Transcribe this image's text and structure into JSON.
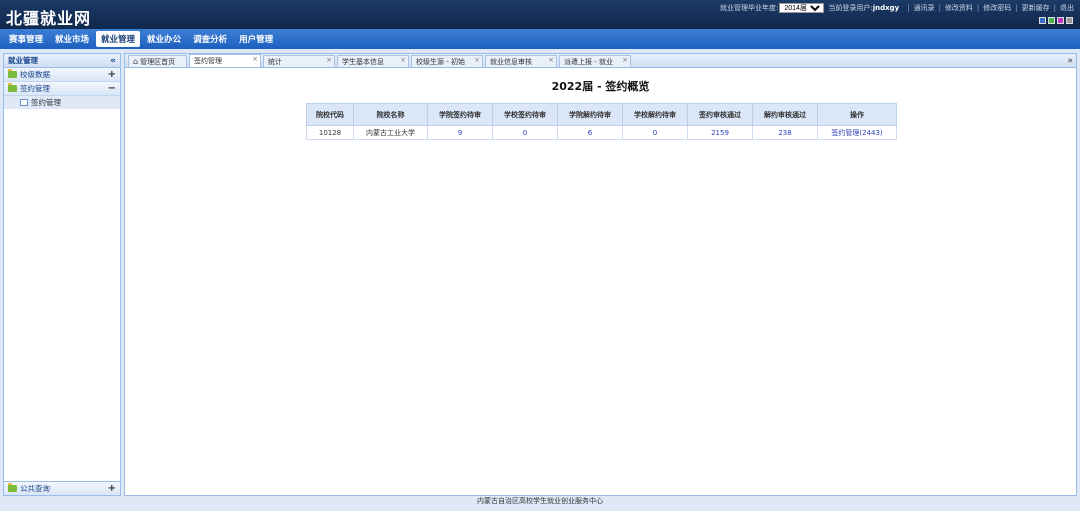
{
  "header": {
    "logo": "北疆就业网",
    "year_label": "就业管理毕业年度:",
    "year_selected": "2014届",
    "user_label": "当前登录用户:",
    "user_name": "jndxgy",
    "links": [
      "通讯录",
      "修改资料",
      "修改密码",
      "更新缓存",
      "退出"
    ],
    "swatches": [
      "#3a6fc9",
      "#4cb34c",
      "#c23ac2",
      "#9a9a9a"
    ]
  },
  "nav": {
    "items": [
      "赛事管理",
      "就业市场",
      "就业管理",
      "就业办公",
      "调查分析",
      "用户管理"
    ],
    "active_index": 2
  },
  "sidebar": {
    "title": "就业管理",
    "collapse_icon": "«",
    "groups": [
      {
        "label": "校级数据",
        "toggle": "+"
      },
      {
        "label": "签约管理",
        "toggle": "−"
      }
    ],
    "tree_item": "签约管理",
    "bottom_group": {
      "label": "公共查询",
      "toggle": "+"
    }
  },
  "tabs": [
    {
      "label": "管理区首页",
      "closable": false
    },
    {
      "label": "签约管理",
      "closable": true
    },
    {
      "label": "统计",
      "closable": true
    },
    {
      "label": "学生基本信息",
      "closable": true
    },
    {
      "label": "校级生源 - 初始",
      "closable": true
    },
    {
      "label": "就业信息审核",
      "closable": true
    },
    {
      "label": "派遣上报 - 就业",
      "closable": true
    }
  ],
  "tab_scroll_icon": "»",
  "content": {
    "title": "2022届 - 签约概览",
    "table": {
      "headers": [
        "院校代码",
        "院校名称",
        "学院签约待审",
        "学校签约待审",
        "学院解约待审",
        "学校解约待审",
        "签约审核通过",
        "解约审核通过",
        "操作"
      ],
      "rows": [
        [
          "10128",
          "内蒙古工业大学",
          "9",
          "0",
          "6",
          "0",
          "2159",
          "238",
          "签约管理(2443)"
        ]
      ]
    }
  },
  "footer": "内蒙古自治区高校学生就业创业服务中心"
}
